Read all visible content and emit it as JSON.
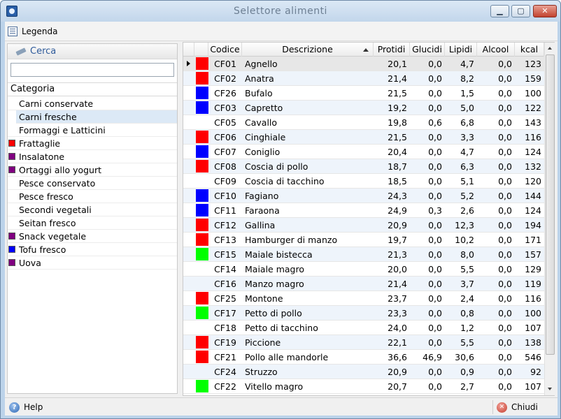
{
  "window": {
    "title": "Selettore alimenti",
    "min_glyph": "▁",
    "max_glyph": "▢",
    "close_glyph": "✕"
  },
  "toolbar": {
    "legend_label": "Legenda",
    "legend_icon": "list-icon"
  },
  "search": {
    "header_label": "Cerca",
    "icon": "pencil-icon",
    "value": ""
  },
  "categories": {
    "header": "Categoria",
    "items": [
      {
        "label": "Carni conservate",
        "color": ""
      },
      {
        "label": "Carni fresche",
        "color": "",
        "selected": true
      },
      {
        "label": "Formaggi e Latticini",
        "color": ""
      },
      {
        "label": "Frattaglie",
        "color": "#ff0000"
      },
      {
        "label": "Insalatone",
        "color": "#800080"
      },
      {
        "label": "Ortaggi allo yogurt",
        "color": "#800080"
      },
      {
        "label": "Pesce conservato",
        "color": ""
      },
      {
        "label": "Pesce fresco",
        "color": ""
      },
      {
        "label": "Secondi vegetali",
        "color": ""
      },
      {
        "label": "Seitan fresco",
        "color": ""
      },
      {
        "label": "Snack vegetale",
        "color": "#800080"
      },
      {
        "label": "Tofu fresco",
        "color": "#0000ff"
      },
      {
        "label": "Uova",
        "color": "#800080"
      }
    ]
  },
  "grid": {
    "columns": {
      "code": "Codice",
      "description": "Descrizione",
      "protein": "Protidi",
      "carbs": "Glucidi",
      "fat": "Lipidi",
      "alcohol": "Alcool",
      "kcal": "kcal"
    },
    "rows": [
      {
        "color": "#ff0000",
        "code": "CF01",
        "desc": "Agnello",
        "prot": "20,1",
        "gluc": "0,0",
        "lip": "4,7",
        "alc": "0,0",
        "kcal": "123"
      },
      {
        "color": "#ff0000",
        "code": "CF02",
        "desc": "Anatra",
        "prot": "21,4",
        "gluc": "0,0",
        "lip": "8,2",
        "alc": "0,0",
        "kcal": "159"
      },
      {
        "color": "#0000ff",
        "code": "CF26",
        "desc": "Bufalo",
        "prot": "21,5",
        "gluc": "0,0",
        "lip": "1,5",
        "alc": "0,0",
        "kcal": "100"
      },
      {
        "color": "#0000ff",
        "code": "CF03",
        "desc": "Capretto",
        "prot": "19,2",
        "gluc": "0,0",
        "lip": "5,0",
        "alc": "0,0",
        "kcal": "122"
      },
      {
        "color": "",
        "code": "CF05",
        "desc": "Cavallo",
        "prot": "19,8",
        "gluc": "0,6",
        "lip": "6,8",
        "alc": "0,0",
        "kcal": "143"
      },
      {
        "color": "#ff0000",
        "code": "CF06",
        "desc": "Cinghiale",
        "prot": "21,5",
        "gluc": "0,0",
        "lip": "3,3",
        "alc": "0,0",
        "kcal": "116"
      },
      {
        "color": "#0000ff",
        "code": "CF07",
        "desc": "Coniglio",
        "prot": "20,4",
        "gluc": "0,0",
        "lip": "4,7",
        "alc": "0,0",
        "kcal": "124"
      },
      {
        "color": "#ff0000",
        "code": "CF08",
        "desc": "Coscia di pollo",
        "prot": "18,7",
        "gluc": "0,0",
        "lip": "6,3",
        "alc": "0,0",
        "kcal": "132"
      },
      {
        "color": "",
        "code": "CF09",
        "desc": "Coscia di tacchino",
        "prot": "18,5",
        "gluc": "0,0",
        "lip": "5,1",
        "alc": "0,0",
        "kcal": "120"
      },
      {
        "color": "#0000ff",
        "code": "CF10",
        "desc": "Fagiano",
        "prot": "24,3",
        "gluc": "0,0",
        "lip": "5,2",
        "alc": "0,0",
        "kcal": "144"
      },
      {
        "color": "#0000ff",
        "code": "CF11",
        "desc": "Faraona",
        "prot": "24,9",
        "gluc": "0,3",
        "lip": "2,6",
        "alc": "0,0",
        "kcal": "124"
      },
      {
        "color": "#ff0000",
        "code": "CF12",
        "desc": "Gallina",
        "prot": "20,9",
        "gluc": "0,0",
        "lip": "12,3",
        "alc": "0,0",
        "kcal": "194"
      },
      {
        "color": "#ff0000",
        "code": "CF13",
        "desc": "Hamburger di manzo",
        "prot": "19,7",
        "gluc": "0,0",
        "lip": "10,2",
        "alc": "0,0",
        "kcal": "171"
      },
      {
        "color": "#00ff00",
        "code": "CF15",
        "desc": "Maiale bistecca",
        "prot": "21,3",
        "gluc": "0,0",
        "lip": "8,0",
        "alc": "0,0",
        "kcal": "157"
      },
      {
        "color": "",
        "code": "CF14",
        "desc": "Maiale magro",
        "prot": "20,0",
        "gluc": "0,0",
        "lip": "5,5",
        "alc": "0,0",
        "kcal": "129"
      },
      {
        "color": "",
        "code": "CF16",
        "desc": "Manzo magro",
        "prot": "21,4",
        "gluc": "0,0",
        "lip": "3,7",
        "alc": "0,0",
        "kcal": "119"
      },
      {
        "color": "#ff0000",
        "code": "CF25",
        "desc": "Montone",
        "prot": "23,7",
        "gluc": "0,0",
        "lip": "2,4",
        "alc": "0,0",
        "kcal": "116"
      },
      {
        "color": "#00ff00",
        "code": "CF17",
        "desc": "Petto di pollo",
        "prot": "23,3",
        "gluc": "0,0",
        "lip": "0,8",
        "alc": "0,0",
        "kcal": "100"
      },
      {
        "color": "",
        "code": "CF18",
        "desc": "Petto di tacchino",
        "prot": "24,0",
        "gluc": "0,0",
        "lip": "1,2",
        "alc": "0,0",
        "kcal": "107"
      },
      {
        "color": "#ff0000",
        "code": "CF19",
        "desc": "Piccione",
        "prot": "22,1",
        "gluc": "0,0",
        "lip": "5,5",
        "alc": "0,0",
        "kcal": "138"
      },
      {
        "color": "#ff0000",
        "code": "CF21",
        "desc": "Pollo alle mandorle",
        "prot": "36,6",
        "gluc": "46,9",
        "lip": "30,6",
        "alc": "0,0",
        "kcal": "546"
      },
      {
        "color": "",
        "code": "CF24",
        "desc": "Struzzo",
        "prot": "20,9",
        "gluc": "0,0",
        "lip": "0,9",
        "alc": "0,0",
        "kcal": "92"
      },
      {
        "color": "#00ff00",
        "code": "CF22",
        "desc": "Vitello magro",
        "prot": "20,7",
        "gluc": "0,0",
        "lip": "2,7",
        "alc": "0,0",
        "kcal": "107"
      }
    ]
  },
  "statusbar": {
    "help_label": "Help",
    "help_icon": "help-icon",
    "close_label": "Chiudi",
    "close_icon": "close-icon"
  }
}
